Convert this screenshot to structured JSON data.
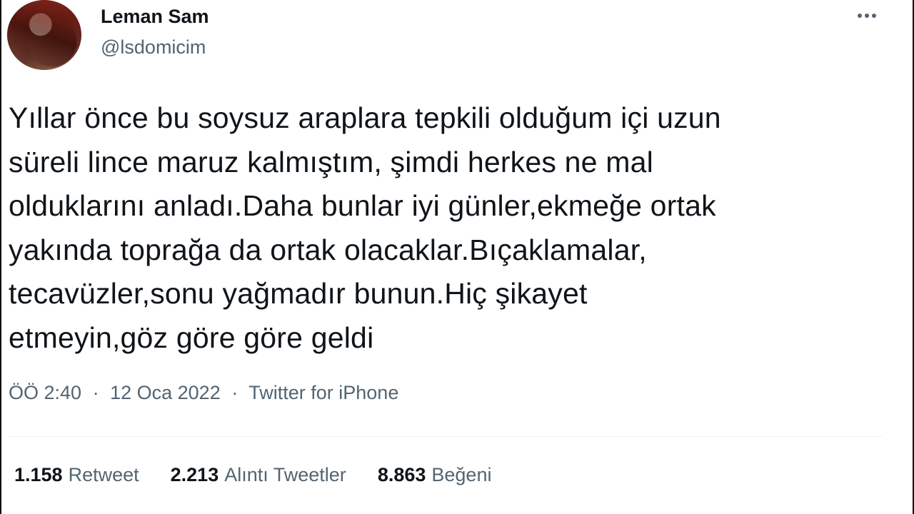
{
  "user": {
    "display_name": "Leman Sam",
    "handle": "@lsdomicim",
    "avatar": "profile-photo"
  },
  "tweet": {
    "text": "Yıllar önce bu soysuz araplara tepkili olduğum içi uzun\nsüreli lince maruz kalmıştım, şimdi herkes ne mal\nolduklarını anladı.Daha bunlar iyi günler,ekmeğe ortak\nyakında toprağa da ortak olacaklar.Bıçaklamalar,\ntecavüzler,sonu yağmadır bunun.Hiç şikayet\netmeyin,göz göre göre geldi",
    "time": "ÖÖ 2:40",
    "separator": "·",
    "date": "12 Oca 2022",
    "source": "Twitter for iPhone"
  },
  "stats": {
    "retweets": {
      "count": "1.158",
      "label": "Retweet"
    },
    "quotes": {
      "count": "2.213",
      "label": "Alıntı Tweetler"
    },
    "likes": {
      "count": "8.863",
      "label": "Beğeni"
    }
  },
  "icons": {
    "more": "more-horizontal-icon"
  },
  "colors": {
    "text_primary": "#0f1419",
    "text_secondary": "#536471",
    "divider": "#eff3f4"
  }
}
